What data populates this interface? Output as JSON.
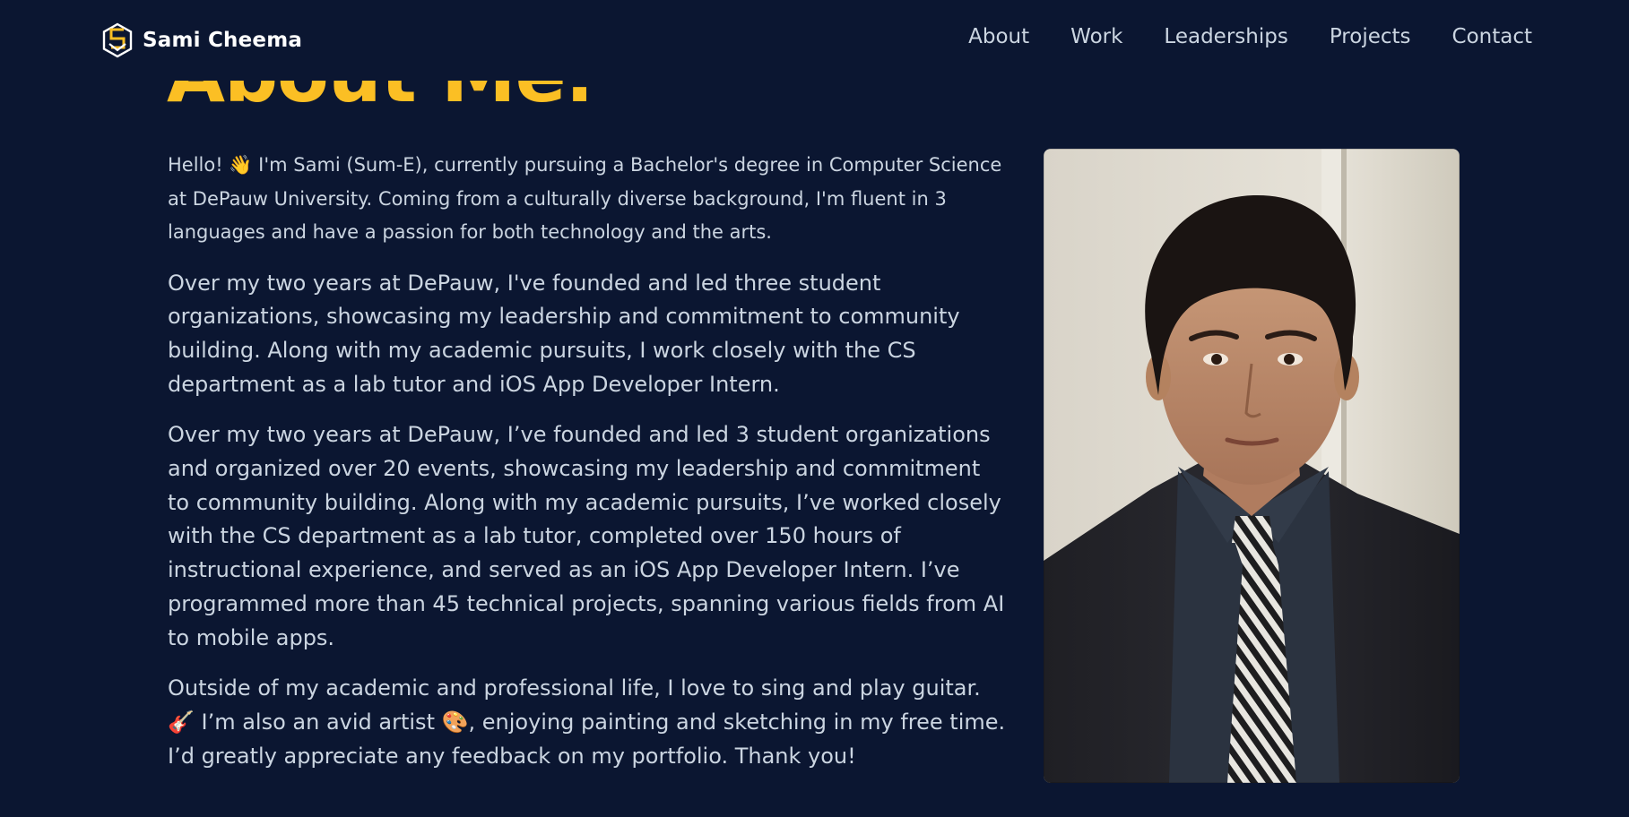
{
  "header": {
    "brand_name": "Sami Cheema",
    "logo_icon": "hexagon-monogram-icon",
    "nav": [
      {
        "label": "About"
      },
      {
        "label": "Work"
      },
      {
        "label": "Leaderships"
      },
      {
        "label": "Projects"
      },
      {
        "label": "Contact"
      }
    ]
  },
  "about": {
    "title": "About Me.",
    "paragraphs": [
      "Hello! 👋 I'm Sami (Sum-E), currently pursuing a Bachelor's degree in Computer Science at DePauw University. Coming from a culturally diverse background, I'm fluent in 3 languages and have a passion for both technology and the arts.",
      "Over my two years at DePauw, I've founded and led three student organizations, showcasing my leadership and commitment to community building. Along with my academic pursuits, I work closely with the CS department as a lab tutor and iOS App Developer Intern.",
      "Over my two years at DePauw, I’ve founded and led 3 student organizations and organized over 20 events, showcasing my leadership and commitment to community building. Along with my academic pursuits, I’ve worked closely with the CS department as a lab tutor, completed over 150 hours of instructional experience, and served as an iOS App Developer Intern. I’ve programmed more than 45 technical projects, spanning various fields from AI to mobile apps.",
      "Outside of my academic and professional life, I love to sing and play guitar. 🎸 I’m also an avid artist 🎨, enjoying painting and sketching in my free time. I’d greatly appreciate any feedback on my portfolio. Thank you!"
    ]
  },
  "colors": {
    "background": "#0b1631",
    "accent": "#fbbf24",
    "text": "#cbd5e1",
    "brand_text": "#ffffff"
  }
}
